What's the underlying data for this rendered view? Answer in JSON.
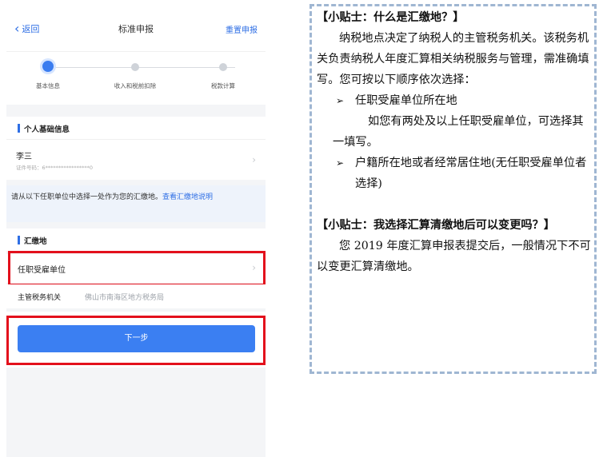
{
  "phone": {
    "nav": {
      "back_label": "返回",
      "title": "标准申报",
      "reset_label": "重置申报"
    },
    "steps": [
      {
        "label": "基本信息",
        "active": true
      },
      {
        "label": "收入和税前扣除",
        "active": false
      },
      {
        "label": "税款计算",
        "active": false
      }
    ],
    "personal_section": {
      "title": "个人基础信息"
    },
    "person": {
      "name": "李三",
      "id_line": "证件号码：6*****************0"
    },
    "notice": {
      "text": "请从以下任职单位中选择一处作为您的汇缴地。",
      "link": "查看汇缴地说明"
    },
    "location_section": {
      "title": "汇缴地"
    },
    "employer_option": {
      "label": "任职受雇单位"
    },
    "tax_authority": {
      "label": "主管税务机关",
      "value": "佛山市南海区地方税务局"
    },
    "next_button": "下一步",
    "highlight_color": "#e3101c",
    "accent_color": "#3b7ff2"
  },
  "tips": {
    "tip1_title": "【小贴士：什么是汇缴地？】",
    "tip1_para": "纳税地点决定了纳税人的主管税务机关。该税务机关负责纳税人年度汇算相关纳税服务与管理，需准确填写。您可按以下顺序依次选择：",
    "bullet_icon": "arrow-right-icon",
    "item1": "任职受雇单位所在地",
    "item1_note": "如您有两处及以上任职受雇单位，可选择其一填写。",
    "item2": "户籍所在地或者经常居住地(无任职受雇单位者选择)",
    "tip2_title": "【小贴士：我选择汇算清缴地后可以变更吗？】",
    "tip2_para": "您 2019 年度汇算申报表提交后，一般情况下不可以变更汇算清缴地。"
  }
}
